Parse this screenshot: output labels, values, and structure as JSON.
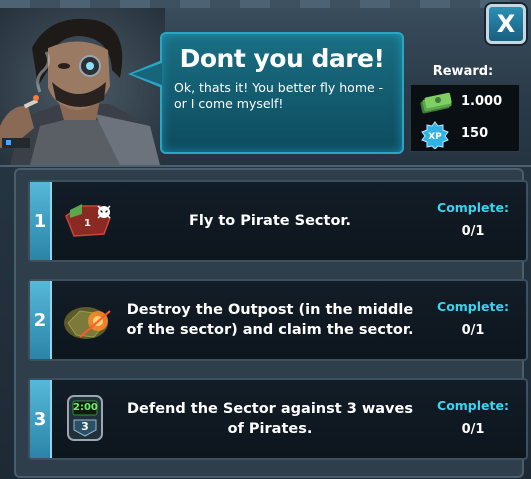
{
  "dialog": {
    "title": "Dont you dare!",
    "message": "Ok, thats it! You better fly home - or I come myself!",
    "close_label": "X"
  },
  "reward": {
    "label": "Reward:",
    "items": [
      {
        "icon": "cash-icon",
        "value": "1.000"
      },
      {
        "icon": "xp-icon",
        "value": "150"
      }
    ]
  },
  "tasks": [
    {
      "number": "1",
      "icon": "pirate-sector-icon",
      "description": "Fly to Pirate Sector.",
      "complete_label": "Complete:",
      "progress": "0/1",
      "icon_badge": "1"
    },
    {
      "number": "2",
      "icon": "outpost-icon",
      "description": "Destroy the Outpost (in the middle of the sector) and claim the sector.",
      "complete_label": "Complete:",
      "progress": "0/1"
    },
    {
      "number": "3",
      "icon": "timer-icon",
      "description": "Defend the Sector against 3 waves of Pirates.",
      "complete_label": "Complete:",
      "progress": "0/1",
      "timer_text": "2:00",
      "timer_count": "3"
    }
  ],
  "colors": {
    "accent": "#3ad4f0",
    "step": "#57b8d8",
    "speech": "#1a6f84"
  }
}
